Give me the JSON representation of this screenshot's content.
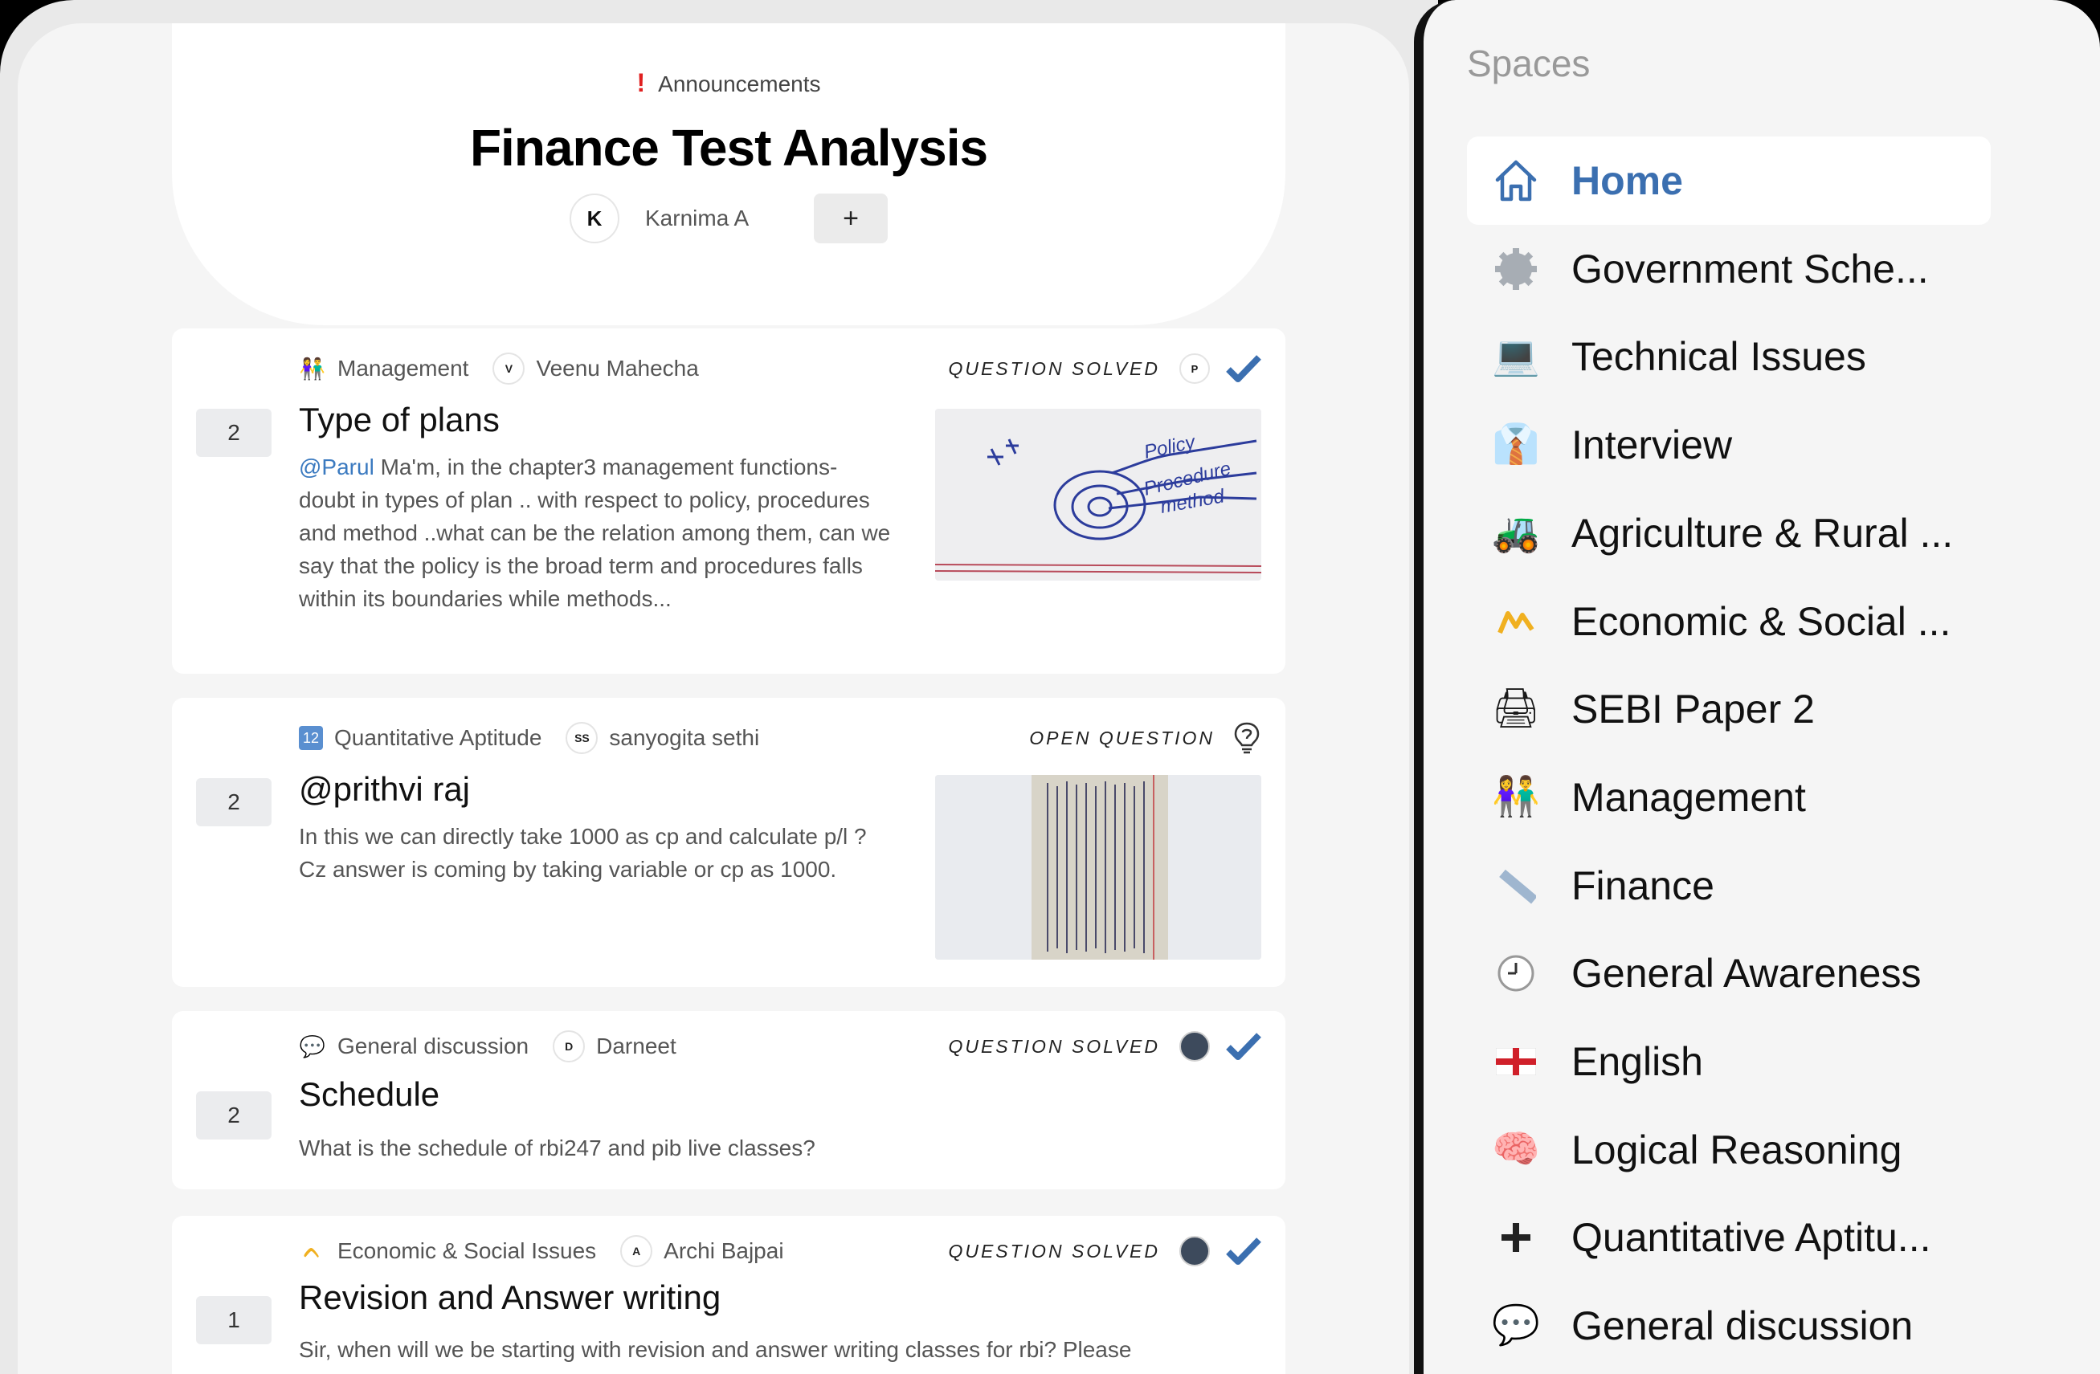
{
  "header": {
    "announcement_label": "Announcements",
    "title": "Finance Test Analysis",
    "member_initial": "K",
    "member_name": "Karnima A",
    "add_label": "+"
  },
  "posts": [
    {
      "votes": "2",
      "space_icon": "people-holding-hands-icon",
      "space": "Management",
      "author_initial": "V",
      "author": "Veenu Mahecha",
      "status": "QUESTION SOLVED",
      "solver_initial": "P",
      "title": "Type of plans",
      "mention": "@Parul",
      "body": " Ma'm, in the chapter3 management functions-doubt in types of plan .. with respect to policy, procedures and method ..what can be the relation among them, can we say that the policy is the broad term and procedures falls within its boundaries while methods...",
      "image_text": [
        "Policy",
        "Procedure",
        "method"
      ]
    },
    {
      "votes": "2",
      "space_icon": "numbers-icon",
      "space": "Quantitative Aptitude",
      "author_initial": "SS",
      "author": "sanyogita sethi",
      "status": "OPEN QUESTION",
      "title": "@prithvi raj",
      "body": "In this we can directly take 1000 as cp and calculate p/l ? Cz answer is coming by taking variable or cp as 1000."
    },
    {
      "votes": "2",
      "space_icon": "speech-bubble-icon",
      "space": "General discussion",
      "author_initial": "D",
      "author": "Darneet",
      "status": "QUESTION SOLVED",
      "title": "Schedule",
      "body": "What is the schedule of rbi247 and pib live classes?"
    },
    {
      "votes": "1",
      "space_icon": "chart-up-icon",
      "space": "Economic & Social Issues",
      "author_initial": "A",
      "author": "Archi Bajpai",
      "status": "QUESTION SOLVED",
      "title": "Revision and Answer writing",
      "body": "Sir, when will we be starting with revision and answer writing classes for rbi? Please"
    }
  ],
  "sidebar": {
    "heading": "Spaces",
    "items": [
      {
        "label": "Home",
        "icon": "home-icon",
        "glyph": "",
        "active": true
      },
      {
        "label": "Government Sche...",
        "icon": "gear-icon",
        "glyph": "✹"
      },
      {
        "label": "Technical Issues",
        "icon": "laptop-icon",
        "glyph": "💻"
      },
      {
        "label": "Interview",
        "icon": "necktie-icon",
        "glyph": "👔"
      },
      {
        "label": "Agriculture & Rural ...",
        "icon": "tractor-icon",
        "glyph": "🚜"
      },
      {
        "label": "Economic & Social ...",
        "icon": "chart-up-icon",
        "glyph": "Ɱ"
      },
      {
        "label": "SEBI Paper 2",
        "icon": "printer-icon",
        "glyph": "🖨"
      },
      {
        "label": "Management",
        "icon": "people-holding-hands-icon",
        "glyph": "👫"
      },
      {
        "label": "Finance",
        "icon": "ruler-icon",
        "glyph": "📏"
      },
      {
        "label": "General Awareness",
        "icon": "clock-icon",
        "glyph": "🕒"
      },
      {
        "label": "English",
        "icon": "england-flag-icon",
        "glyph": "✚"
      },
      {
        "label": "Logical Reasoning",
        "icon": "brain-icon",
        "glyph": "🧠"
      },
      {
        "label": "Quantitative Aptitu...",
        "icon": "plus-icon",
        "glyph": "➕"
      },
      {
        "label": "General discussion",
        "icon": "speech-bubble-icon",
        "glyph": "💬"
      }
    ]
  },
  "colors": {
    "accent": "#3b6fb0",
    "check": "#3b6fb0",
    "announcement_bang": "#e02020",
    "mention": "#3b7ac0"
  }
}
